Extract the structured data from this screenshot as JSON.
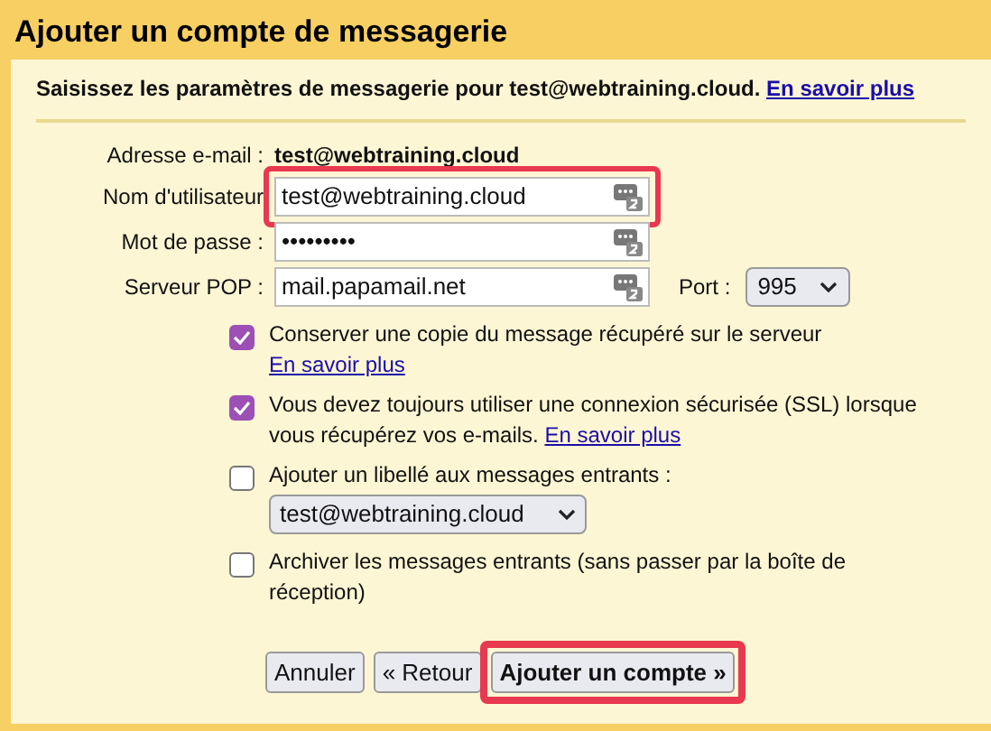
{
  "window": {
    "title": "Ajouter un compte de messagerie"
  },
  "intro": {
    "text": "Saisissez les paramètres de messagerie pour test@webtraining.cloud.",
    "link": "En savoir plus"
  },
  "email": {
    "label": "Adresse e-mail :",
    "value": "test@webtraining.cloud"
  },
  "fields": [
    {
      "label": "Nom d'utilisateur",
      "value": "test@webtraining.cloud",
      "highlighted": true
    },
    {
      "label": "Mot de passe :",
      "value": "•••••••••",
      "highlighted": false
    },
    {
      "label": "Serveur POP :",
      "value": "mail.papamail.net",
      "highlighted": false
    }
  ],
  "port": {
    "label": "Port :",
    "value": "995"
  },
  "options": [
    {
      "text": "Conserver une copie du message récupéré sur le serveur",
      "link": "En savoir plus",
      "checked": true
    },
    {
      "text": "Vous devez toujours utiliser une connexion sécurisée (SSL) lorsque vous récupérez vos e-mails.",
      "link": "En savoir plus",
      "checked": true
    },
    {
      "text": "Ajouter un libellé aux messages entrants :",
      "select": "test@webtraining.cloud",
      "checked": false
    },
    {
      "text": "Archiver les messages entrants (sans passer par la boîte de réception)",
      "checked": false
    }
  ],
  "buttons": [
    {
      "label": "Annuler",
      "primary": false,
      "highlighted": false
    },
    {
      "label": "« Retour",
      "primary": false,
      "highlighted": false
    },
    {
      "label": "Ajouter un compte »",
      "primary": true,
      "highlighted": true
    }
  ]
}
